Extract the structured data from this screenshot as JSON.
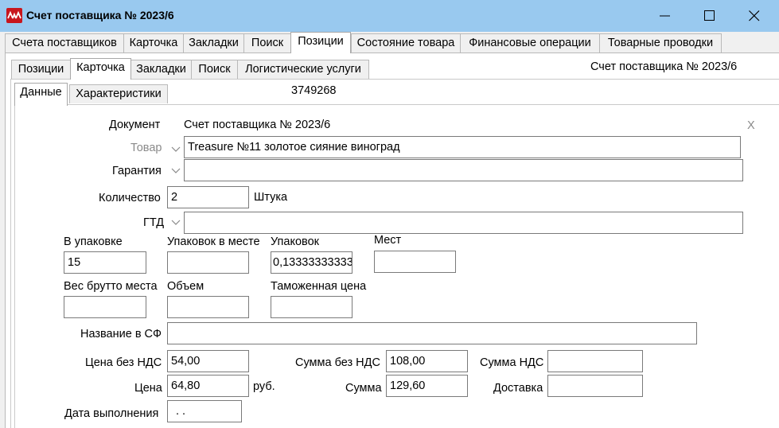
{
  "window": {
    "title": "Счет поставщика № 2023/6"
  },
  "tabs_main": [
    "Счета поставщиков",
    "Карточка",
    "Закладки",
    "Поиск",
    "Позиции",
    "Состояние товара",
    "Финансовые операции",
    "Товарные проводки"
  ],
  "tabs_sub": [
    "Позиции",
    "Карточка",
    "Закладки",
    "Поиск",
    "Логистические услуги"
  ],
  "tabs_card": [
    "Данные",
    "Характеристики"
  ],
  "header": {
    "right_title": "Счет поставщика № 2023/6",
    "record_id": "3749268",
    "close_x": "X"
  },
  "form": {
    "document_label": "Документ",
    "document_value": "Счет поставщика № 2023/6",
    "product_label": "Товар",
    "product_value": "Treasure №11 золотое сияние виноград",
    "warranty_label": "Гарантия",
    "warranty_value": "",
    "quantity_label": "Количество",
    "quantity_value": "2",
    "unit": "Штука",
    "gtd_label": "ГТД",
    "gtd_value": "",
    "per_pack_label": "В упаковке",
    "per_pack_value": "15",
    "packs_in_place_label": "Упаковок в месте",
    "packs_in_place_value": "",
    "packs_label": "Упаковок",
    "packs_value": "0,13333333333",
    "places_label": "Мест",
    "places_value": "",
    "gross_weight_label": "Вес брутто места",
    "gross_weight_value": "",
    "volume_label": "Объем",
    "volume_value": "",
    "customs_price_label": "Таможенная цена",
    "customs_price_value": "",
    "sf_name_label": "Название в СФ",
    "sf_name_value": "",
    "price_no_vat_label": "Цена без НДС",
    "price_no_vat_value": "54,00",
    "sum_no_vat_label": "Сумма без НДС",
    "sum_no_vat_value": "108,00",
    "vat_sum_label": "Сумма НДС",
    "vat_sum_value": "",
    "price_label": "Цена",
    "price_value": "64,80",
    "currency": "руб.",
    "sum_label": "Сумма",
    "sum_value": "129,60",
    "delivery_label": "Доставка",
    "delivery_value": "",
    "completion_date_label": "Дата выполнения",
    "completion_date_value": ". ."
  },
  "colors": {
    "titlebar": "#99c9ef",
    "app_icon": "#c8161d"
  }
}
